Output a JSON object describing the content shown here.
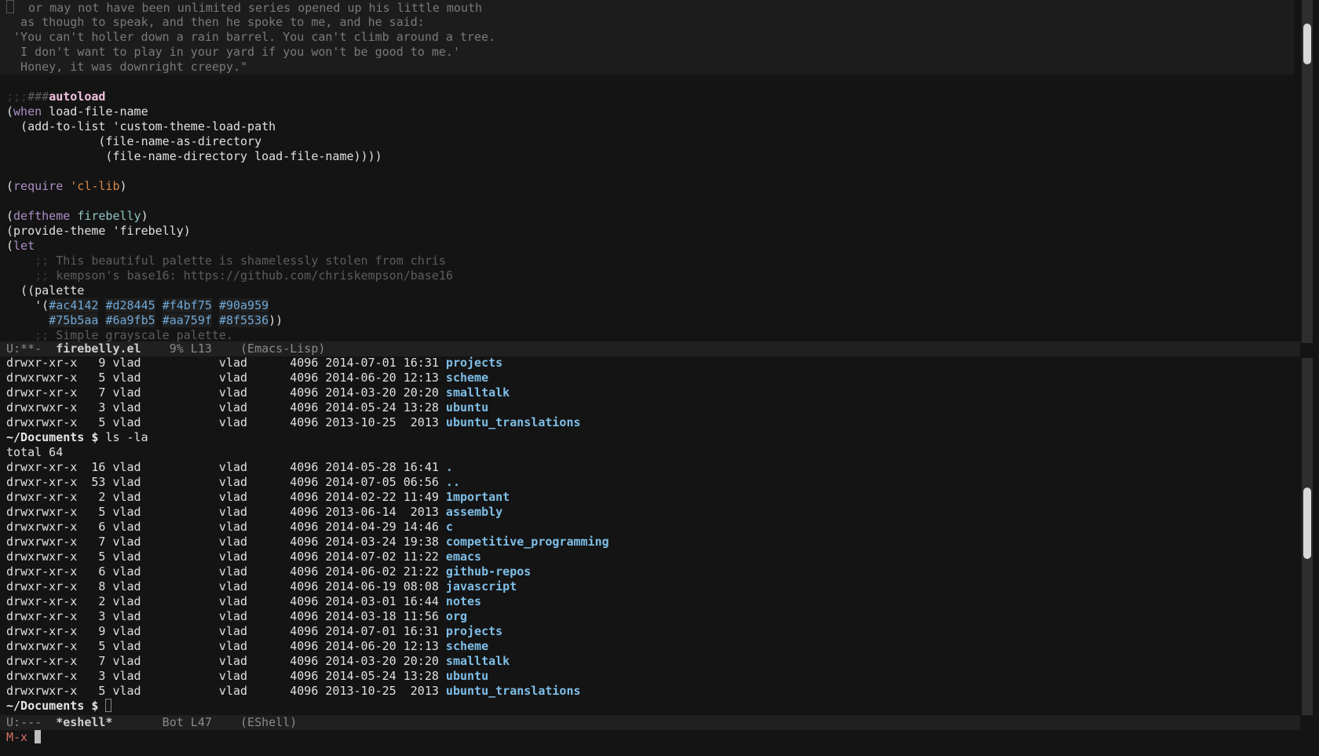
{
  "top_buffer": {
    "quote_lines": [
      "  or may not have been unlimited series opened up his little mouth",
      "  as though to speak, and then he spoke to me, and he said:",
      " 'You can't holler down a rain barrel. You can't climb around a tree.",
      "  I don't want to play in your yard if you won't be good to me.'",
      "  Honey, it was downright creepy.\""
    ],
    "autoload_prefix": ";;;",
    "autoload_hash": "###",
    "autoload_word": "autoload",
    "when_kw": "when",
    "when_rest": " load-file-name",
    "add_to_list": "  (add-to-list 'custom-theme-load-path",
    "fnad": "             (file-name-as-directory",
    "fnd": "              (file-name-directory load-file-name))))",
    "require_kw": "require",
    "require_arg": "'cl-lib",
    "deftheme_kw": "deftheme",
    "deftheme_arg": "firebelly",
    "provide_line": "(provide-theme 'firebelly)",
    "let_kw": "let",
    "comment1": "This beautiful palette is shamelessly stolen from chris",
    "comment2": "kempson's base16: https://github.com/chriskempson/base16",
    "comment_prefix": "    ;; ",
    "palette_line": "  ((palette",
    "palette_row1": [
      "#ac4142",
      "#d28445",
      "#f4bf75",
      "#90a959"
    ],
    "palette_row2": [
      "#75b5aa",
      "#6a9fb5",
      "#aa759f",
      "#8f5536"
    ],
    "comment3": "Simple grayscale palette."
  },
  "modeline_top": {
    "status": "U:**-  ",
    "buffer": "firebelly.el",
    "position": "    9% L13    ",
    "mode": "(Emacs-Lisp)"
  },
  "eshell": {
    "pre_listing": [
      {
        "perms": "drwxr-xr-x",
        "links": "9",
        "owner": "vlad",
        "group": "vlad",
        "size": "4096",
        "date": "2014-07-01",
        "time": "16:31",
        "name": "projects"
      },
      {
        "perms": "drwxrwxr-x",
        "links": "5",
        "owner": "vlad",
        "group": "vlad",
        "size": "4096",
        "date": "2014-06-20",
        "time": "12:13",
        "name": "scheme"
      },
      {
        "perms": "drwxr-xr-x",
        "links": "7",
        "owner": "vlad",
        "group": "vlad",
        "size": "4096",
        "date": "2014-03-20",
        "time": "20:20",
        "name": "smalltalk"
      },
      {
        "perms": "drwxrwxr-x",
        "links": "3",
        "owner": "vlad",
        "group": "vlad",
        "size": "4096",
        "date": "2014-05-24",
        "time": "13:28",
        "name": "ubuntu"
      },
      {
        "perms": "drwxrwxr-x",
        "links": "5",
        "owner": "vlad",
        "group": "vlad",
        "size": "4096",
        "date": "2013-10-25",
        "time": " 2013",
        "name": "ubuntu_translations"
      }
    ],
    "prompt": "~/Documents $",
    "command": " ls -la",
    "total": "total 64",
    "listing": [
      {
        "perms": "drwxr-xr-x",
        "links": "16",
        "owner": "vlad",
        "group": "vlad",
        "size": "4096",
        "date": "2014-05-28",
        "time": "16:41",
        "name": "."
      },
      {
        "perms": "drwxr-xr-x",
        "links": "53",
        "owner": "vlad",
        "group": "vlad",
        "size": "4096",
        "date": "2014-07-05",
        "time": "06:56",
        "name": ".."
      },
      {
        "perms": "drwxr-xr-x",
        "links": "2",
        "owner": "vlad",
        "group": "vlad",
        "size": "4096",
        "date": "2014-02-22",
        "time": "11:49",
        "name": "1mportant"
      },
      {
        "perms": "drwxrwxr-x",
        "links": "5",
        "owner": "vlad",
        "group": "vlad",
        "size": "4096",
        "date": "2013-06-14",
        "time": " 2013",
        "name": "assembly"
      },
      {
        "perms": "drwxrwxr-x",
        "links": "6",
        "owner": "vlad",
        "group": "vlad",
        "size": "4096",
        "date": "2014-04-29",
        "time": "14:46",
        "name": "c"
      },
      {
        "perms": "drwxrwxr-x",
        "links": "7",
        "owner": "vlad",
        "group": "vlad",
        "size": "4096",
        "date": "2014-03-24",
        "time": "19:38",
        "name": "competitive_programming"
      },
      {
        "perms": "drwxrwxr-x",
        "links": "5",
        "owner": "vlad",
        "group": "vlad",
        "size": "4096",
        "date": "2014-07-02",
        "time": "11:22",
        "name": "emacs"
      },
      {
        "perms": "drwxr-xr-x",
        "links": "6",
        "owner": "vlad",
        "group": "vlad",
        "size": "4096",
        "date": "2014-06-02",
        "time": "21:22",
        "name": "github-repos"
      },
      {
        "perms": "drwxr-xr-x",
        "links": "8",
        "owner": "vlad",
        "group": "vlad",
        "size": "4096",
        "date": "2014-06-19",
        "time": "08:08",
        "name": "javascript"
      },
      {
        "perms": "drwxr-xr-x",
        "links": "2",
        "owner": "vlad",
        "group": "vlad",
        "size": "4096",
        "date": "2014-03-01",
        "time": "16:44",
        "name": "notes"
      },
      {
        "perms": "drwxr-xr-x",
        "links": "3",
        "owner": "vlad",
        "group": "vlad",
        "size": "4096",
        "date": "2014-03-18",
        "time": "11:56",
        "name": "org"
      },
      {
        "perms": "drwxr-xr-x",
        "links": "9",
        "owner": "vlad",
        "group": "vlad",
        "size": "4096",
        "date": "2014-07-01",
        "time": "16:31",
        "name": "projects"
      },
      {
        "perms": "drwxrwxr-x",
        "links": "5",
        "owner": "vlad",
        "group": "vlad",
        "size": "4096",
        "date": "2014-06-20",
        "time": "12:13",
        "name": "scheme"
      },
      {
        "perms": "drwxr-xr-x",
        "links": "7",
        "owner": "vlad",
        "group": "vlad",
        "size": "4096",
        "date": "2014-03-20",
        "time": "20:20",
        "name": "smalltalk"
      },
      {
        "perms": "drwxrwxr-x",
        "links": "3",
        "owner": "vlad",
        "group": "vlad",
        "size": "4096",
        "date": "2014-05-24",
        "time": "13:28",
        "name": "ubuntu"
      },
      {
        "perms": "drwxrwxr-x",
        "links": "5",
        "owner": "vlad",
        "group": "vlad",
        "size": "4096",
        "date": "2013-10-25",
        "time": " 2013",
        "name": "ubuntu_translations"
      }
    ],
    "final_prompt": "~/Documents $"
  },
  "modeline_bottom": {
    "status": "U:---  ",
    "buffer": "*eshell*",
    "position": "       Bot L47    ",
    "mode": "(EShell)"
  },
  "minibuffer": {
    "text": "M-x "
  },
  "scrollbars": {
    "top_thumb_fraction": 0.12,
    "bottom_thumb_fraction": 0.2
  }
}
